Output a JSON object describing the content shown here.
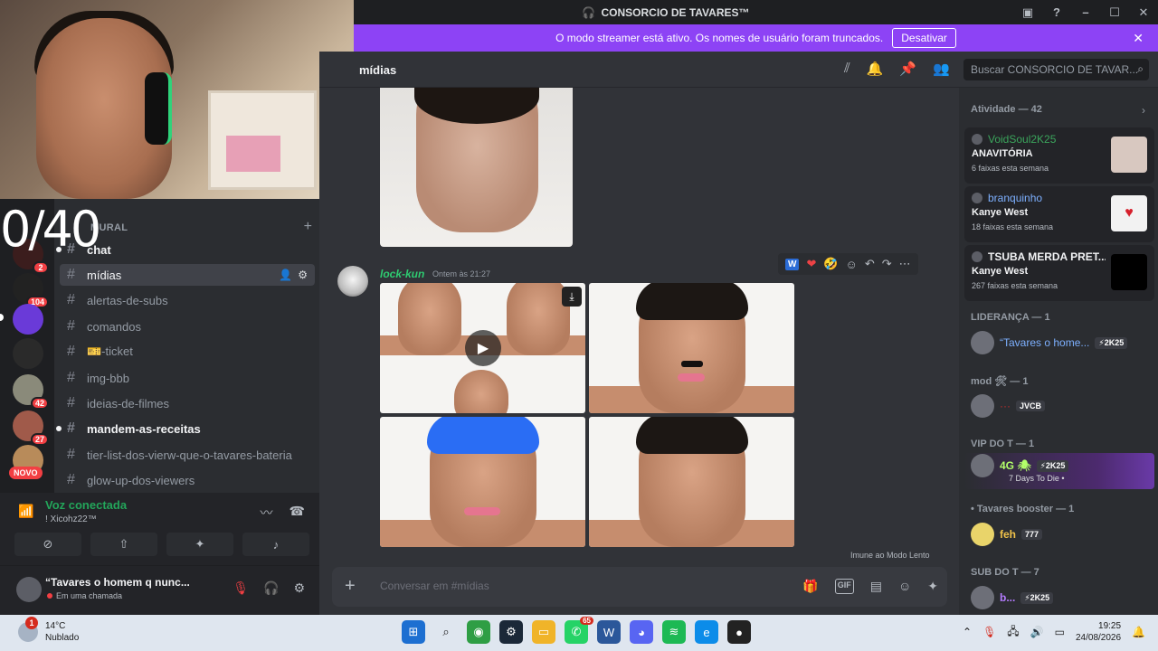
{
  "window": {
    "title": "CONSORCIO DE TAVARES™"
  },
  "banner": {
    "text": "O modo streamer está ativo. Os nomes de usuário foram truncados.",
    "button": "Desativar"
  },
  "overlay": {
    "counter": "0/40"
  },
  "rail": {
    "badges": [
      "2",
      "104",
      "42",
      "27"
    ],
    "novo": "NOVO"
  },
  "channels": {
    "category": "MURAL",
    "items": [
      {
        "label": "chat",
        "state": "unread"
      },
      {
        "label": "mídias",
        "state": "active"
      },
      {
        "label": "alertas-de-subs",
        "state": "normal"
      },
      {
        "label": "comandos",
        "state": "normal"
      },
      {
        "label": "🎫-ticket",
        "state": "normal"
      },
      {
        "label": "img-bbb",
        "state": "normal"
      },
      {
        "label": "ideias-de-filmes",
        "state": "normal"
      },
      {
        "label": "mandem-as-receitas",
        "state": "unread"
      },
      {
        "label": "tier-list-dos-vierw-que-o-tavares-bateria",
        "state": "normal"
      },
      {
        "label": "glow-up-dos-viewers",
        "state": "normal"
      }
    ]
  },
  "voice": {
    "status": "Voz conectada",
    "server": "! Xicohz22™"
  },
  "user": {
    "name": "“Tavares o homem q nunc...",
    "status": "Em uma chamada"
  },
  "chat": {
    "channel_name": "mídias",
    "search_placeholder": "Buscar CONSORCIO DE TAVAR...",
    "message": {
      "author": "lock-kun",
      "time": "Ontem às 21:27"
    },
    "reactions": [
      "W",
      "❤",
      "🤣"
    ],
    "slowmode": "Imune ao Modo Lento",
    "composer_placeholder": "Conversar em #mídias"
  },
  "members": {
    "activity_header": "Atividade — 42",
    "activities": [
      {
        "user": "VoidSoul2K25",
        "song": "ANAVITÓRIA",
        "sub": "6 faixas esta semana",
        "color": "green"
      },
      {
        "user": "branquinho",
        "song": "Kanye West",
        "sub": "18 faixas esta semana",
        "color": "blue"
      },
      {
        "user": "TSUBA MERDA PRET...",
        "song": "Kanye West",
        "sub": "267 faixas esta semana",
        "color": "white"
      }
    ],
    "groups": [
      {
        "header": "LIDERANÇA — 1",
        "name": "“Tavares o home...",
        "tag": "⚡2K25",
        "color": "blue"
      },
      {
        "header": "mod 🛠 — 1",
        "name": "···",
        "tag": "JVCB",
        "color": "red"
      },
      {
        "header": "VIP DO T — 1",
        "name": "4G 🕷",
        "tag": "⚡2K25",
        "color": "green",
        "sub": "7 Days To Die •"
      },
      {
        "header": "• Tavares booster — 1",
        "name": "feh",
        "tag": "777",
        "color": "yellow"
      },
      {
        "header": "SUB DO T — 7",
        "name": "b...",
        "tag": "⚡2K25",
        "color": "purple"
      }
    ]
  },
  "taskbar": {
    "weather_badge": "1",
    "temp": "14°C",
    "weather": "Nublado",
    "whatsapp_count": "65",
    "time": "19:25",
    "date": "24/08/2026"
  },
  "colors": {
    "banner": "#8d43f5",
    "online": "#23a55a",
    "danger": "#f23f43",
    "bg_main": "#313338",
    "bg_sidebar": "#2b2d31"
  }
}
